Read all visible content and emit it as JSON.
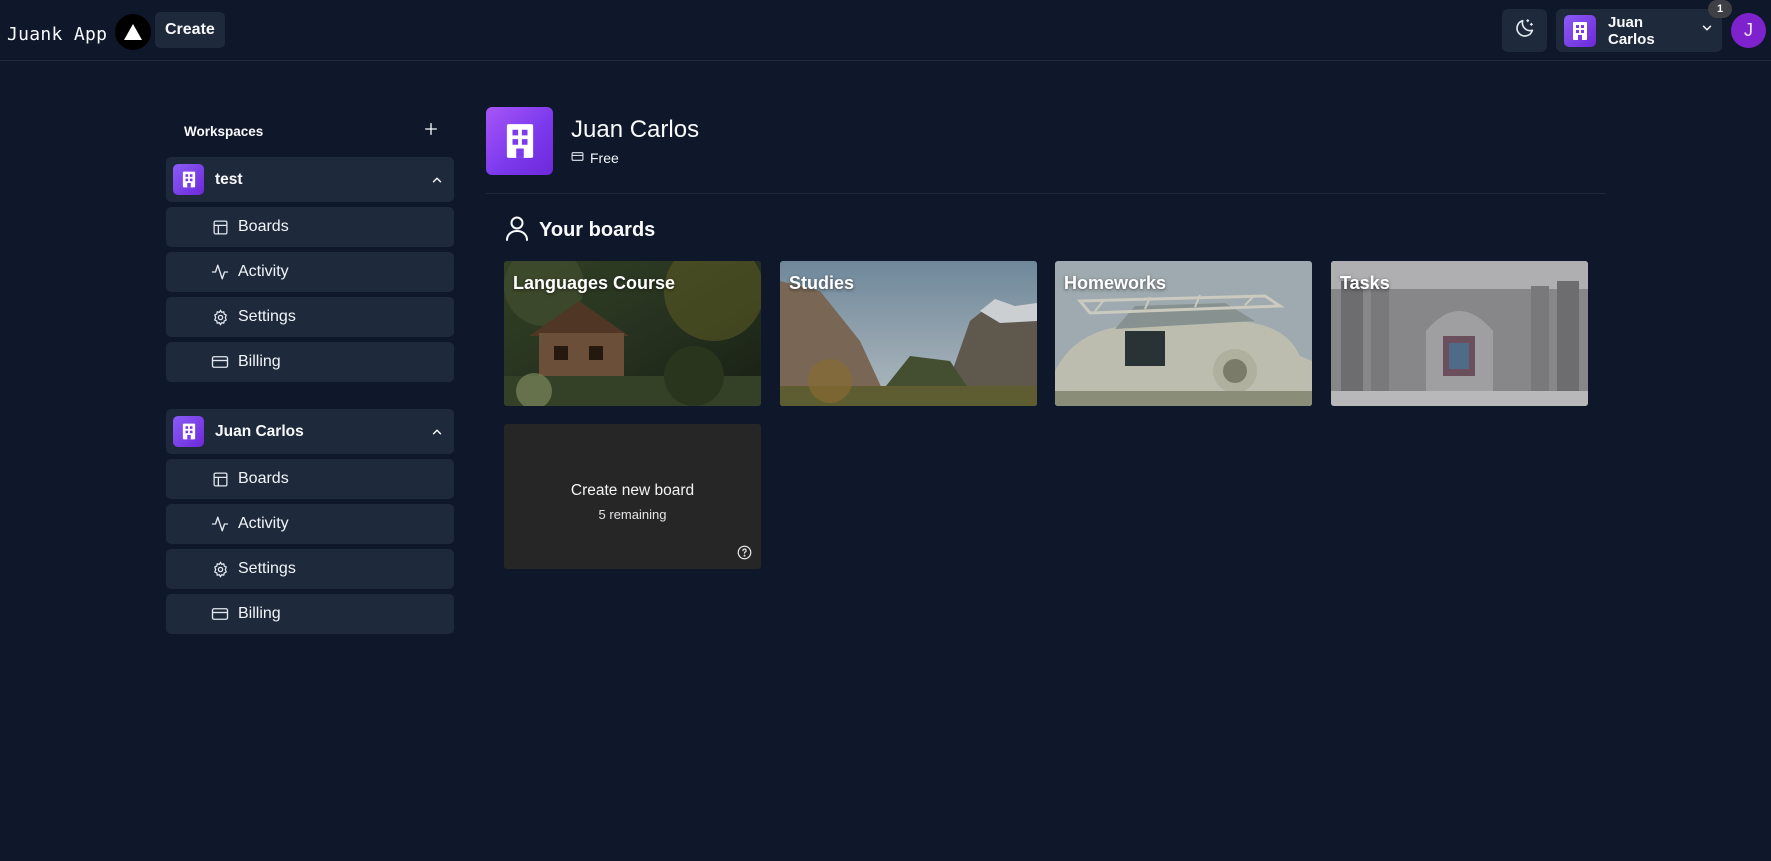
{
  "nav": {
    "brand": "Juank App",
    "create_label": "Create",
    "org_switcher_name": "Juan Carlos",
    "notification_count": "1",
    "avatar_initial": "J"
  },
  "sidebar": {
    "title": "Workspaces",
    "workspaces": [
      {
        "name": "test",
        "items": [
          {
            "label": "Boards",
            "icon": "layout-icon"
          },
          {
            "label": "Activity",
            "icon": "activity-icon"
          },
          {
            "label": "Settings",
            "icon": "gear-icon"
          },
          {
            "label": "Billing",
            "icon": "credit-card-icon"
          }
        ]
      },
      {
        "name": "Juan Carlos",
        "items": [
          {
            "label": "Boards",
            "icon": "layout-icon"
          },
          {
            "label": "Activity",
            "icon": "activity-icon"
          },
          {
            "label": "Settings",
            "icon": "gear-icon"
          },
          {
            "label": "Billing",
            "icon": "credit-card-icon"
          }
        ]
      }
    ]
  },
  "org": {
    "name": "Juan Carlos",
    "plan": "Free"
  },
  "boards": {
    "heading": "Your boards",
    "items": [
      {
        "title": "Languages Course"
      },
      {
        "title": "Studies"
      },
      {
        "title": "Homeworks"
      },
      {
        "title": "Tasks"
      }
    ],
    "create": {
      "label": "Create new board",
      "remaining": "5 remaining"
    }
  },
  "colors": {
    "background": "#0f172a",
    "surface": "#1e293b",
    "accent": "#7c3aed",
    "avatar": "#7e22ce",
    "create_card": "#262626"
  }
}
